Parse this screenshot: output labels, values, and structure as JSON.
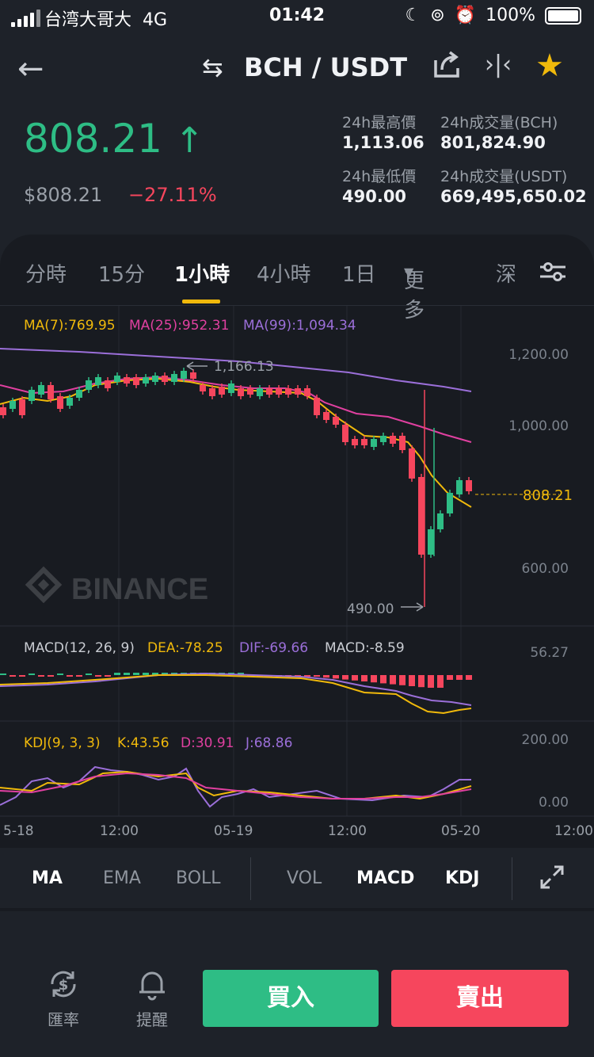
{
  "status": {
    "carrier": "台湾大哥大",
    "network": "4G",
    "time": "01:42",
    "battery": "100%"
  },
  "header": {
    "pair": "BCH / USDT",
    "icons": [
      "back-arrow-icon",
      "swap-icon",
      "share-icon",
      "compare-icon",
      "star-icon"
    ]
  },
  "ticker": {
    "price": "808.21",
    "direction": "↑",
    "fiat": "$808.21",
    "change": "−27.11%",
    "high_label": "24h最高價",
    "high": "1,113.06",
    "vol_base_label": "24h成交量(BCH)",
    "vol_base": "801,824.90",
    "low_label": "24h最低價",
    "low": "490.00",
    "vol_quote_label": "24h成交量(USDT)",
    "vol_quote": "669,495,650.02"
  },
  "tabs": {
    "items": [
      "分時",
      "15分",
      "1小時",
      "4小時",
      "1日",
      "更多",
      "深"
    ],
    "active": "1小時"
  },
  "chart": {
    "ma7": "MA(7):769.95",
    "ma25": "MA(25):952.31",
    "ma99": "MA(99):1,094.34",
    "high_marker": "1,166.13",
    "low_marker": "490.00",
    "last_price": "808.21",
    "watermark": "BINANCE",
    "price_axis": [
      "1,200.00",
      "1,000.00",
      "600.00"
    ],
    "macd_label": "MACD(12, 26, 9)",
    "dea": "DEA:-78.25",
    "dif": "DIF:-69.66",
    "macd": "MACD:-8.59",
    "macd_axis": "56.27",
    "kdj_label": "KDJ(9, 3, 3)",
    "k": "K:43.56",
    "d": "D:30.91",
    "j": "J:68.86",
    "kdj_axis": [
      "200.00",
      "0.00"
    ],
    "time_axis": [
      "5-18",
      "12:00",
      "05-19",
      "12:00",
      "05-20",
      "12:00"
    ],
    "colors": {
      "up": "#2ebd85",
      "down": "#f6465d",
      "ma7": "#f0b90b",
      "ma25": "#e040a0",
      "ma99": "#9b6fd9"
    }
  },
  "indicators": {
    "main": [
      "MA",
      "EMA",
      "BOLL"
    ],
    "sub": [
      "VOL",
      "MACD",
      "KDJ"
    ],
    "selected": [
      "MA",
      "MACD",
      "KDJ"
    ]
  },
  "bottom": {
    "peek": "…",
    "rate_label": "匯率",
    "alert_label": "提醒",
    "buy": "買入",
    "sell": "賣出",
    "buy_color": "#2ebd85",
    "sell_color": "#f6465d"
  }
}
